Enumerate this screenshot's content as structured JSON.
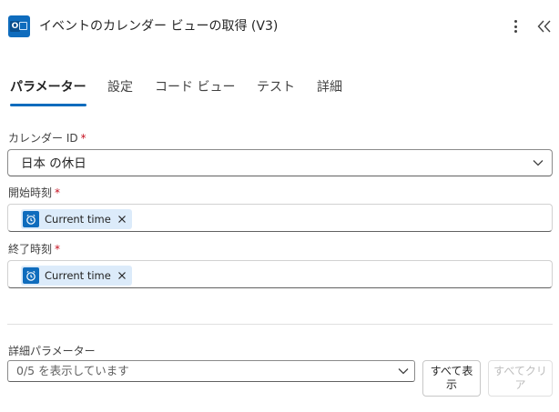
{
  "header": {
    "app_icon": "outlook-icon",
    "title": "イベントのカレンダー ビューの取得 (V3)",
    "more_icon": "more-vertical-icon",
    "collapse_icon": "collapse-double-chevron-icon"
  },
  "tabs": [
    {
      "label": "パラメーター",
      "active": true
    },
    {
      "label": "設定",
      "active": false
    },
    {
      "label": "コード ビュー",
      "active": false
    },
    {
      "label": "テスト",
      "active": false
    },
    {
      "label": "詳細",
      "active": false
    }
  ],
  "fields": {
    "calendar_id": {
      "label": "カレンダー ID",
      "required_mark": "*",
      "value": "日本 の休日"
    },
    "start_time": {
      "label": "開始時刻",
      "required_mark": "*",
      "token": {
        "icon": "alarm-clock-icon",
        "label": "Current time"
      }
    },
    "end_time": {
      "label": "終了時刻",
      "required_mark": "*",
      "token": {
        "icon": "alarm-clock-icon",
        "label": "Current time"
      }
    }
  },
  "advanced": {
    "label": "詳細パラメーター",
    "value": "0/5 を表示しています",
    "show_all_label": "すべて表示",
    "clear_all_label": "すべてクリア"
  },
  "colors": {
    "accent": "#0f6cbd",
    "token_bg": "#dcebfa",
    "required": "#c50f1f",
    "disabled_text": "#bdbdbd"
  }
}
